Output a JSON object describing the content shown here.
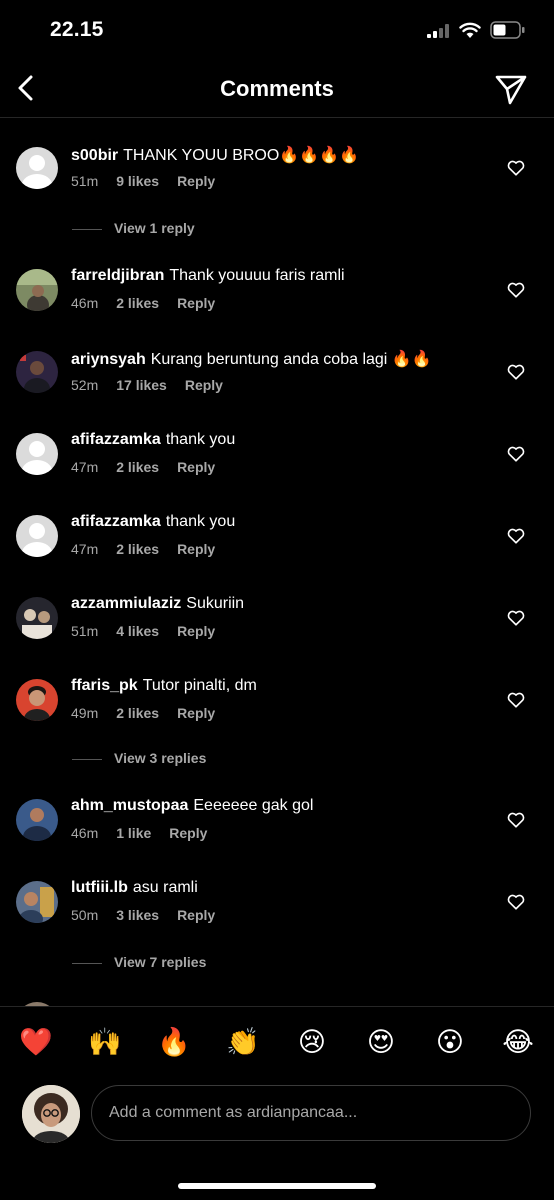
{
  "status_bar": {
    "time": "22.15"
  },
  "header": {
    "title": "Comments"
  },
  "comments": [
    {
      "user": "s00bir",
      "text": "THANK YOUU BROO🔥🔥🔥🔥",
      "age": "51m",
      "likes": "9 likes",
      "reply": "Reply",
      "view_replies": "View 1 reply"
    },
    {
      "user": "farreldjibran",
      "text": "Thank youuuu faris ramli",
      "age": "46m",
      "likes": "2 likes",
      "reply": "Reply"
    },
    {
      "user": "ariynsyah",
      "text": "Kurang beruntung anda coba lagi 🔥🔥",
      "age": "52m",
      "likes": "17 likes",
      "reply": "Reply"
    },
    {
      "user": "afifazzamka",
      "text": "thank you",
      "age": "47m",
      "likes": "2 likes",
      "reply": "Reply"
    },
    {
      "user": "afifazzamka",
      "text": "thank you",
      "age": "47m",
      "likes": "2 likes",
      "reply": "Reply"
    },
    {
      "user": "azzammiulaziz",
      "text": "Sukuriin",
      "age": "51m",
      "likes": "4 likes",
      "reply": "Reply"
    },
    {
      "user": "ffaris_pk",
      "text": "Tutor pinalti, dm",
      "age": "49m",
      "likes": "2 likes",
      "reply": "Reply",
      "view_replies": "View 3 replies"
    },
    {
      "user": "ahm_mustopaa",
      "text": "Eeeeeee gak gol",
      "age": "46m",
      "likes": "1 like",
      "reply": "Reply"
    },
    {
      "user": "lutfiii.lb",
      "text": "asu ramli",
      "age": "50m",
      "likes": "3 likes",
      "reply": "Reply",
      "view_replies": "View 7 replies"
    }
  ],
  "emoji_bar": [
    "❤️",
    "🙌",
    "🔥",
    "👏",
    "😢",
    "😍",
    "😮",
    "😂"
  ],
  "composer": {
    "placeholder": "Add a comment as ardianpancaa..."
  }
}
